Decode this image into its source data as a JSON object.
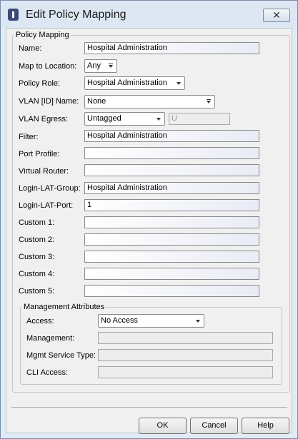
{
  "window": {
    "title": "Edit Policy Mapping",
    "close_label": "✕"
  },
  "group": {
    "title": "Policy Mapping"
  },
  "fields": {
    "name": {
      "label": "Name:",
      "value": "Hospital Administration"
    },
    "map_to_location": {
      "label": "Map to Location:",
      "value": "Any"
    },
    "policy_role": {
      "label": "Policy Role:",
      "value": "Hospital Administration"
    },
    "vlan_name": {
      "label": "VLAN [ID] Name:",
      "value": "None"
    },
    "vlan_egress": {
      "label": "VLAN Egress:",
      "value": "Untagged",
      "tag_value": "U"
    },
    "filter": {
      "label": "Filter:",
      "value": "Hospital Administration"
    },
    "port_profile": {
      "label": "Port Profile:",
      "value": ""
    },
    "virtual_router": {
      "label": "Virtual Router:",
      "value": ""
    },
    "login_lat_group": {
      "label": "Login-LAT-Group:",
      "value": "Hospital Administration"
    },
    "login_lat_port": {
      "label": "Login-LAT-Port:",
      "value": "1"
    },
    "custom1": {
      "label": "Custom 1:",
      "value": ""
    },
    "custom2": {
      "label": "Custom 2:",
      "value": ""
    },
    "custom3": {
      "label": "Custom 3:",
      "value": ""
    },
    "custom4": {
      "label": "Custom 4:",
      "value": ""
    },
    "custom5": {
      "label": "Custom 5:",
      "value": ""
    }
  },
  "management": {
    "title": "Management Attributes",
    "access": {
      "label": "Access:",
      "value": "No Access"
    },
    "management": {
      "label": "Management:",
      "value": ""
    },
    "mgmt_service_type": {
      "label": "Mgmt Service Type:",
      "value": ""
    },
    "cli_access": {
      "label": "CLI Access:",
      "value": ""
    }
  },
  "buttons": {
    "ok": "OK",
    "cancel": "Cancel",
    "help": "Help"
  }
}
